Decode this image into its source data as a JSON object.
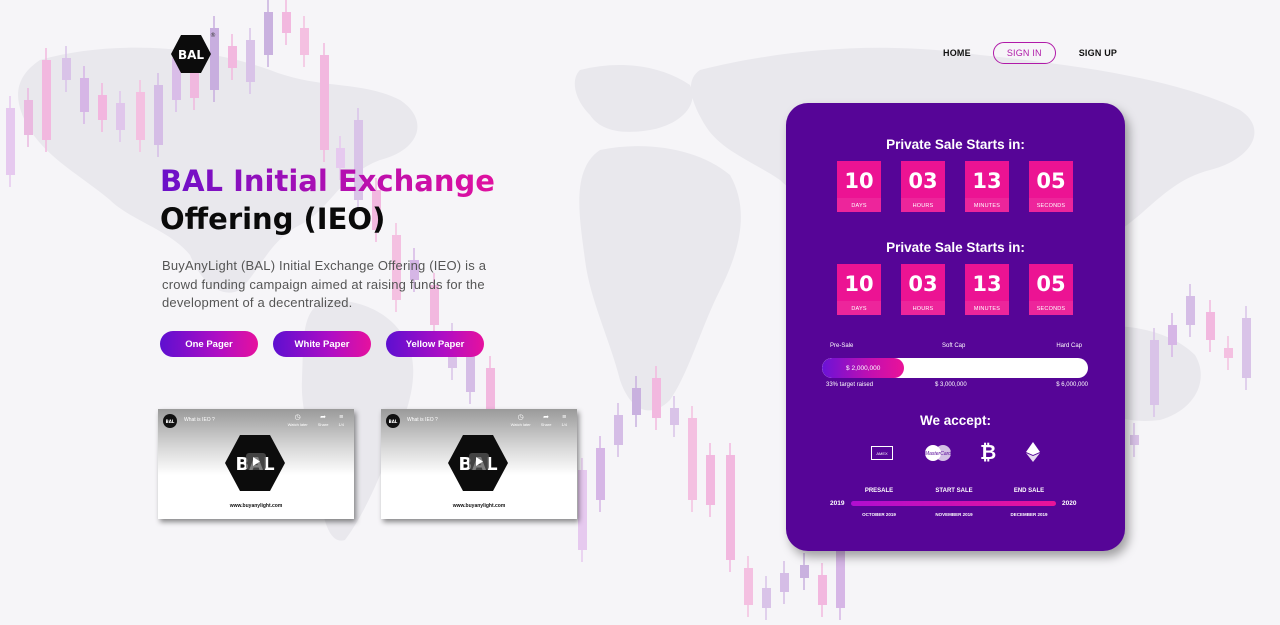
{
  "brand": {
    "logo_text": "BAL",
    "logo_mark": "®"
  },
  "nav": {
    "home": "HOME",
    "sign_in": "SIGN IN",
    "sign_up": "SIGN UP"
  },
  "hero": {
    "title_highlight": "BAL Initial Exchange",
    "title_rest": "Offering (IEO)",
    "description": "BuyAnyLight (BAL) Initial Exchange Offering (IEO) is a crowd funding campaign aimed at raising funds for the development of a decentralized.",
    "buttons": [
      "One Pager",
      "White Paper",
      "Yellow Paper"
    ]
  },
  "videos": [
    {
      "channel": "BAL",
      "title": "What is IEO ?",
      "tools": [
        "Watch later",
        "Share",
        "1/4"
      ],
      "url": "www.buyanylight.com",
      "logo_text": "BAL"
    },
    {
      "channel": "BAL",
      "title": "What is IEO ?",
      "tools": [
        "Watch later",
        "Share",
        "1/4"
      ],
      "url": "www.buyanylight.com",
      "logo_text": "BAL"
    }
  ],
  "countdowns": [
    {
      "title": "Private Sale Starts in:",
      "units": [
        {
          "value": "10",
          "label": "DAYS"
        },
        {
          "value": "03",
          "label": "HOURS"
        },
        {
          "value": "13",
          "label": "MINUTES"
        },
        {
          "value": "05",
          "label": "SECONDS"
        }
      ]
    },
    {
      "title": "Private Sale Starts in:",
      "units": [
        {
          "value": "10",
          "label": "DAYS"
        },
        {
          "value": "03",
          "label": "HOURS"
        },
        {
          "value": "13",
          "label": "MINUTES"
        },
        {
          "value": "05",
          "label": "SECONDS"
        }
      ]
    }
  ],
  "sale": {
    "labels": {
      "pre_sale": "Pre-Sale",
      "soft_cap": "Soft Cap",
      "hard_cap": "Hard Cap"
    },
    "raised_amount": "$ 2,000,000",
    "progress_fraction": 0.31,
    "raised_note": "33% target raised",
    "soft_cap_value": "$ 3,000,000",
    "hard_cap_value": "$ 6,000,000"
  },
  "accept": {
    "title": "We accept:",
    "methods": [
      "amex-icon",
      "mastercard-icon",
      "bitcoin-icon",
      "ethereum-icon"
    ],
    "amex_text": "AMEX",
    "mastercard_text": "MasterCard",
    "bitcoin_glyph": "₿"
  },
  "timeline": {
    "start_year": "2019",
    "end_year": "2020",
    "stages": [
      {
        "label": "PRESALE",
        "date": "OCTOBER 2019"
      },
      {
        "label": "START SALE",
        "date": "NOVEMBER 2019"
      },
      {
        "label": "END SALE",
        "date": "DECEMBER 2019"
      }
    ]
  },
  "colors": {
    "panel": "#560597",
    "countdown_box": "#ec1393",
    "accent_purple": "#6a10c9",
    "accent_pink": "#e0119f",
    "signin_border": "#b01aa8"
  }
}
